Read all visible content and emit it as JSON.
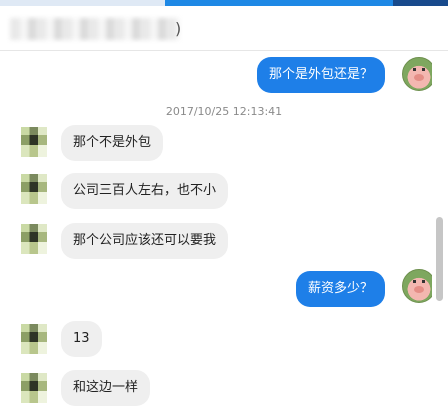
{
  "header": {
    "title_suffix": ")"
  },
  "timestamp": "2017/10/25 12:13:41",
  "messages": [
    {
      "dir": "out",
      "text": "那个是外包还是？"
    },
    {
      "dir": "in",
      "text": "那个不是外包"
    },
    {
      "dir": "in",
      "text": "公司三百人左右，也不小"
    },
    {
      "dir": "in",
      "text": "那个公司应该还可以要我"
    },
    {
      "dir": "out",
      "text": "薪资多少？"
    },
    {
      "dir": "in",
      "text": "13"
    },
    {
      "dir": "in",
      "text": "和这边一样"
    }
  ],
  "colors": {
    "accent": "#1e7fe8",
    "incoming_bubble": "#efefef",
    "timestamp": "#8a8a8a"
  }
}
